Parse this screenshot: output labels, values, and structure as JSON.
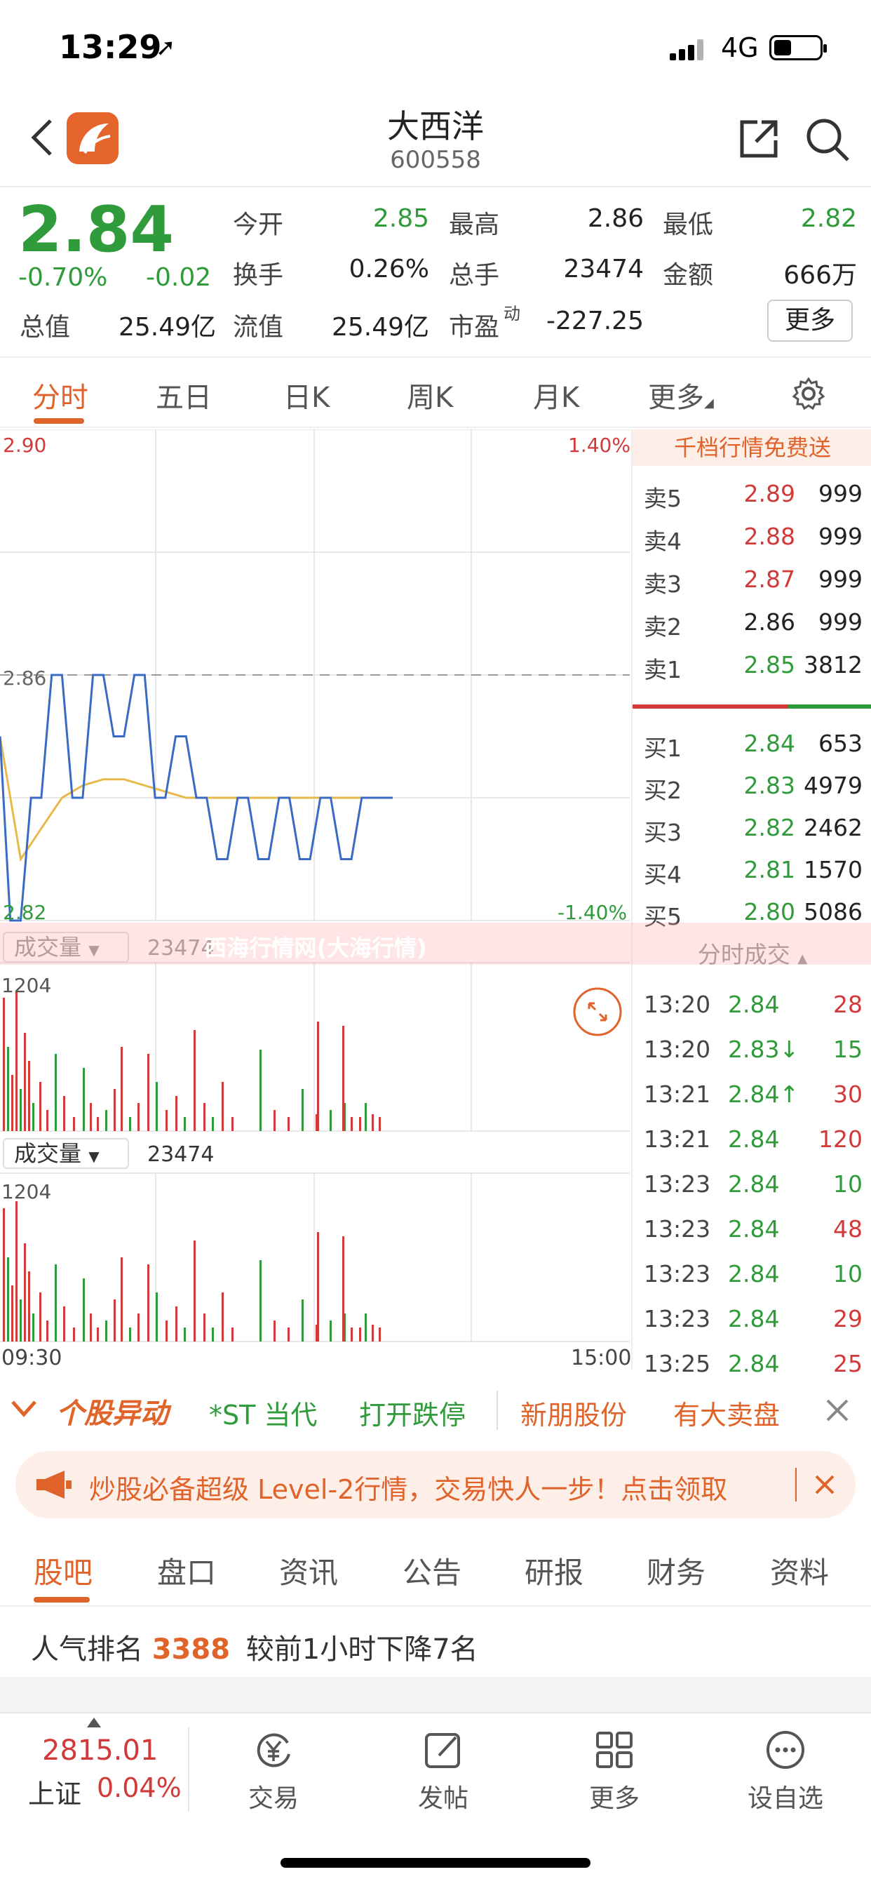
{
  "status": {
    "time": "13:29",
    "network": "4G"
  },
  "nav": {
    "stock_name": "大西洋",
    "stock_code": "600558"
  },
  "quote": {
    "price": "2.84",
    "change_pct": "-0.70%",
    "change_val": "-0.02",
    "open_label": "今开",
    "open_val": "2.85",
    "high_label": "最高",
    "high_val": "2.86",
    "low_label": "最低",
    "low_val": "2.82",
    "turnover_label": "换手",
    "turnover_val": "0.26%",
    "volume_label": "总手",
    "volume_val": "23474",
    "amount_label": "金额",
    "amount_val": "666万",
    "mcap_label": "总值",
    "mcap_val": "25.49亿",
    "float_label": "流值",
    "float_val": "25.49亿",
    "pe_label": "市盈",
    "pe_sup": "动",
    "pe_val": "-227.25",
    "more": "更多"
  },
  "chart_tabs": [
    "分时",
    "五日",
    "日K",
    "周K",
    "月K",
    "更多"
  ],
  "chart": {
    "price_top": "2.90",
    "price_mid": "2.86",
    "price_bot": "2.82",
    "pct_top": "1.40%",
    "pct_bot": "-1.40%",
    "vol_label": "成交量",
    "vol_total": "23474",
    "vol_max": "1204",
    "time_start": "09:30",
    "time_end": "15:00"
  },
  "chart_data": {
    "type": "line",
    "x": [
      "09:30",
      "15:00"
    ],
    "series": [
      {
        "values": [
          2.85,
          2.82,
          2.84,
          2.86,
          2.84,
          2.86,
          2.85,
          2.86,
          2.84,
          2.85,
          2.84,
          2.83,
          2.84,
          2.83,
          2.84,
          2.83,
          2.84,
          2.83,
          2.84,
          2.84
        ]
      },
      {
        "values": [
          2.85,
          2.83,
          2.835,
          2.84,
          2.842,
          2.843,
          2.843,
          2.842,
          2.841,
          2.84,
          2.84,
          2.84,
          2.84,
          2.84,
          2.84,
          2.84,
          2.84,
          2.84,
          2.84,
          2.84
        ]
      }
    ],
    "ylim": [
      2.82,
      2.9
    ]
  },
  "orderbook": {
    "banner": "千档行情免费送",
    "asks": [
      {
        "label": "卖5",
        "price": "2.89",
        "vol": "999"
      },
      {
        "label": "卖4",
        "price": "2.88",
        "vol": "999"
      },
      {
        "label": "卖3",
        "price": "2.87",
        "vol": "999"
      },
      {
        "label": "卖2",
        "price": "2.86",
        "vol": "999"
      },
      {
        "label": "卖1",
        "price": "2.85",
        "vol": "3812"
      }
    ],
    "bids": [
      {
        "label": "买1",
        "price": "2.84",
        "vol": "653"
      },
      {
        "label": "买2",
        "price": "2.83",
        "vol": "4979"
      },
      {
        "label": "买3",
        "price": "2.82",
        "vol": "2462"
      },
      {
        "label": "买4",
        "price": "2.81",
        "vol": "1570"
      },
      {
        "label": "买5",
        "price": "2.80",
        "vol": "5086"
      }
    ]
  },
  "ticks": {
    "header": "分时成交",
    "rows": [
      {
        "t": "13:20",
        "p": "2.84",
        "v": "28"
      },
      {
        "t": "13:20",
        "p": "2.83↓",
        "v": "15"
      },
      {
        "t": "13:21",
        "p": "2.84↑",
        "v": "30"
      },
      {
        "t": "13:21",
        "p": "2.84",
        "v": "120"
      },
      {
        "t": "13:23",
        "p": "2.84",
        "v": "10"
      },
      {
        "t": "13:23",
        "p": "2.84",
        "v": "48"
      },
      {
        "t": "13:23",
        "p": "2.84",
        "v": "10"
      },
      {
        "t": "13:23",
        "p": "2.84",
        "v": "29"
      },
      {
        "t": "13:25",
        "p": "2.84",
        "v": "25"
      }
    ]
  },
  "watermark": "西海行情网(大海行情)",
  "alerts": {
    "title": "个股异动",
    "items": [
      "*ST 当代",
      "打开跌停",
      "新朋股份",
      "有大卖盘"
    ]
  },
  "promo": {
    "text": "炒股必备超级 Level-2行情，交易快人一步！点击领取"
  },
  "bottom_tabs": [
    "股吧",
    "盘口",
    "资讯",
    "公告",
    "研报",
    "财务",
    "资料"
  ],
  "rank": {
    "label": "人气排名",
    "num": "3388",
    "desc": "较前1小时下降7名"
  },
  "toolbar": {
    "index_val": "2815.01",
    "index_name": "上证",
    "index_pct": "0.04%",
    "items": [
      "交易",
      "发帖",
      "更多",
      "设自选"
    ]
  },
  "colors": {
    "accent": "#e0632a",
    "up": "#d23a3a",
    "down": "#2f9b3a"
  }
}
